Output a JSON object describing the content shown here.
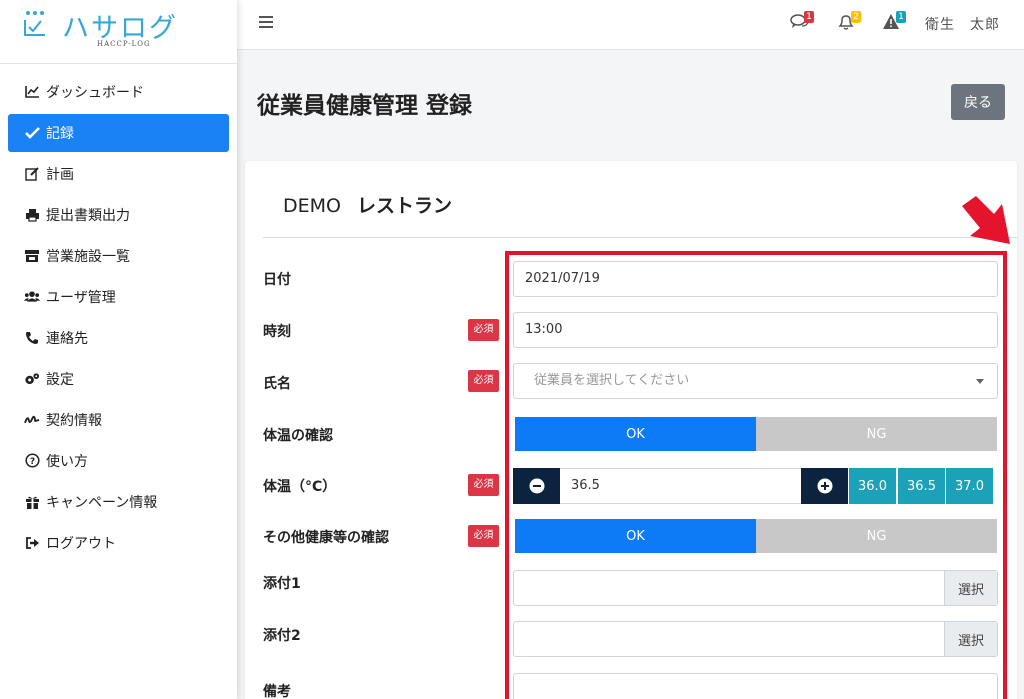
{
  "logo": {
    "title": "ハサログ",
    "subtitle": "HACCP-LOG"
  },
  "sidebar": {
    "items": [
      {
        "label": "ダッシュボード",
        "icon": "chart-line-icon"
      },
      {
        "label": "記録",
        "icon": "check-icon",
        "active": true
      },
      {
        "label": "計画",
        "icon": "edit-icon"
      },
      {
        "label": "提出書類出力",
        "icon": "printer-icon"
      },
      {
        "label": "営業施設一覧",
        "icon": "store-icon"
      },
      {
        "label": "ユーザ管理",
        "icon": "users-icon"
      },
      {
        "label": "連絡先",
        "icon": "phone-icon"
      },
      {
        "label": "設定",
        "icon": "gears-icon"
      },
      {
        "label": "契約情報",
        "icon": "signature-icon"
      },
      {
        "label": "使い方",
        "icon": "question-circle-icon"
      },
      {
        "label": "キャンペーン情報",
        "icon": "gift-icon"
      },
      {
        "label": "ログアウト",
        "icon": "logout-icon"
      }
    ]
  },
  "topbar": {
    "messages_count": "1",
    "notifications_count": "2",
    "alerts_count": "1",
    "user_name": "衛生　太郎",
    "colors": {
      "messages_badge": "#dc3545",
      "notifications_badge": "#ffc107",
      "alerts_badge": "#17a2b8"
    }
  },
  "page": {
    "title": "従業員健康管理 登録",
    "back_label": "戻る"
  },
  "card": {
    "company": "DEMO",
    "restaurant": "レストラン"
  },
  "form": {
    "required_label": "必須",
    "date": {
      "label": "日付",
      "value": "2021/07/19"
    },
    "time": {
      "label": "時刻",
      "value": "13:00"
    },
    "name": {
      "label": "氏名",
      "placeholder": "従業員を選択してください"
    },
    "temp_check": {
      "label": "体温の確認",
      "ok": "OK",
      "ng": "NG",
      "selected": "OK"
    },
    "temperature": {
      "label": "体温（°C）",
      "value": "36.5",
      "presets": [
        "36.0",
        "36.5",
        "37.0"
      ]
    },
    "other_check": {
      "label": "その他健康等の確認",
      "ok": "OK",
      "ng": "NG",
      "selected": "OK"
    },
    "attachment1": {
      "label": "添付1",
      "button": "選択"
    },
    "attachment2": {
      "label": "添付2",
      "button": "選択"
    },
    "notes": {
      "label": "備考"
    }
  },
  "colors": {
    "primary": "#1a82f5",
    "highlight": "#e3142b",
    "info": "#1ba2b8",
    "dark": "#0c2340",
    "secondary": "#6c757d"
  }
}
